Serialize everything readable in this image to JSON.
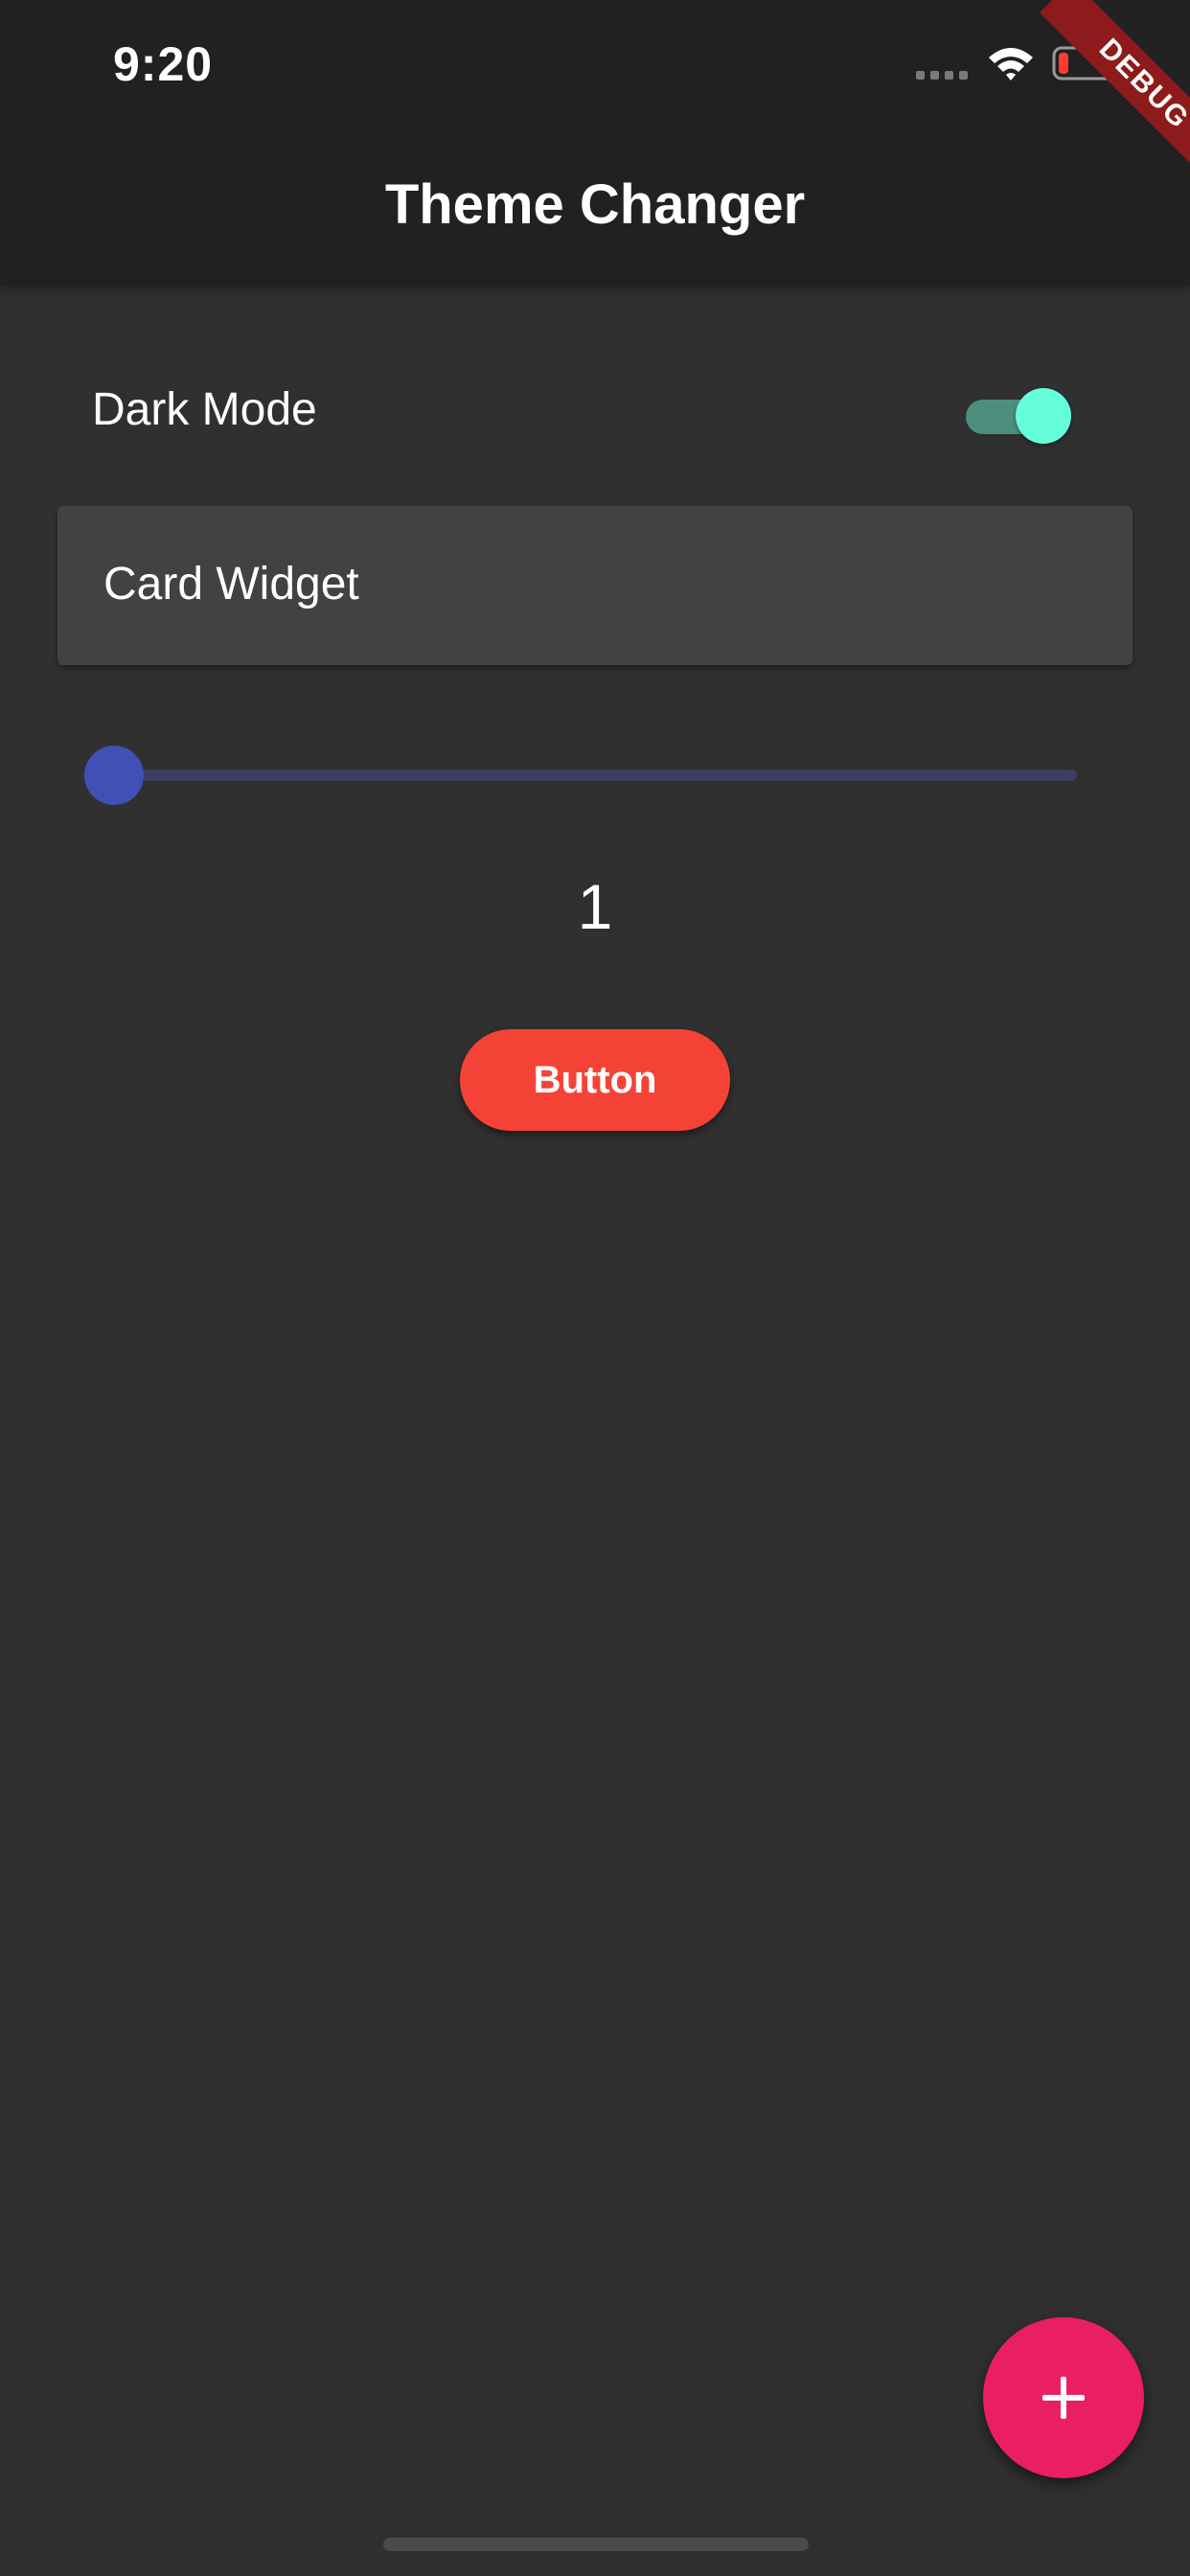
{
  "status_bar": {
    "time": "9:20",
    "icons": [
      "signal-icon",
      "wifi-icon",
      "battery-icon"
    ]
  },
  "app_bar": {
    "title": "Theme Changer"
  },
  "debug_banner": {
    "label": "DEBUG",
    "color": "#8e1b1b"
  },
  "settings": {
    "dark_mode_label": "Dark Mode",
    "dark_mode_on": true
  },
  "card": {
    "text": "Card Widget"
  },
  "slider": {
    "value": 1,
    "position_fraction": 0.0
  },
  "value_display": "1",
  "button": {
    "label": "Button"
  },
  "fab": {
    "icon": "plus-icon"
  },
  "colors": {
    "background": "#303030",
    "app_bar": "#212121",
    "card": "#424242",
    "toggle_accent": "#64ffda",
    "slider_accent": "#3f51b5",
    "button": "#f44336",
    "fab": "#e91e63"
  }
}
